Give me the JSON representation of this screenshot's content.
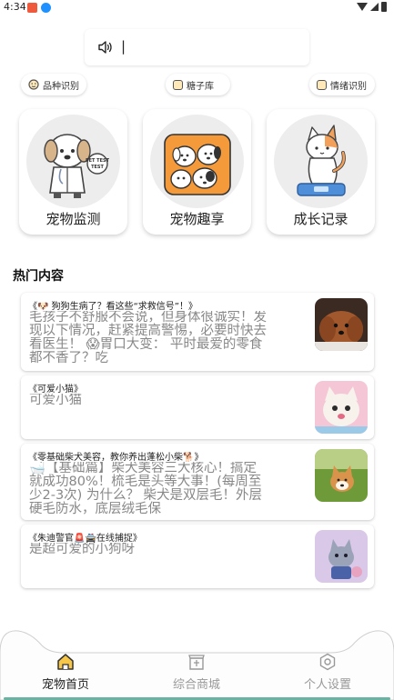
{
  "status_bar": {
    "time": "4:34"
  },
  "voice_search": {
    "cursor": "|"
  },
  "chips": [
    {
      "label": "品种识别",
      "icon": "face-scan-icon"
    },
    {
      "label": "糖子库",
      "icon": "book-icon"
    },
    {
      "label": "情绪识别",
      "icon": "book-icon"
    }
  ],
  "cards": [
    {
      "label": "宠物监测",
      "badge": "PET TEST"
    },
    {
      "label": "宠物趣享"
    },
    {
      "label": "成长记录"
    }
  ],
  "section": {
    "title": "热门内容"
  },
  "articles": [
    {
      "title": "《🐶 狗狗生病了？看这些“求救信号”！》",
      "body": "毛孩子不舒服不会说，但身体很诚实！发现以下情况，赶紧提高警惕，必要时快去看医生！ 😱胃口大变： 平时最爱的零食都不香了？吃"
    },
    {
      "title": "《可爱小猫》",
      "body": "可爱小猫"
    },
    {
      "title": "《零基础柴犬美容，教你养出蓬松小柴🐕》",
      "body": "🛁【基础篇】柴犬美容三大核心！搞定就成功80%！梳毛是头等大事！(每周至少2-3次) 为什么？ 柴犬是双层毛！外层硬毛防水，底层绒毛保"
    },
    {
      "title": "《朱迪警官🚨🚔在线捕捉》",
      "body": "是超可爱的小狗呀"
    }
  ],
  "nav": [
    {
      "label": "宠物首页",
      "active": true
    },
    {
      "label": "综合商城",
      "active": false
    },
    {
      "label": "个人设置",
      "active": false
    }
  ],
  "colors": {
    "accent": "#6ab3a2",
    "muted": "#888888",
    "card_bg": "#ededed"
  }
}
